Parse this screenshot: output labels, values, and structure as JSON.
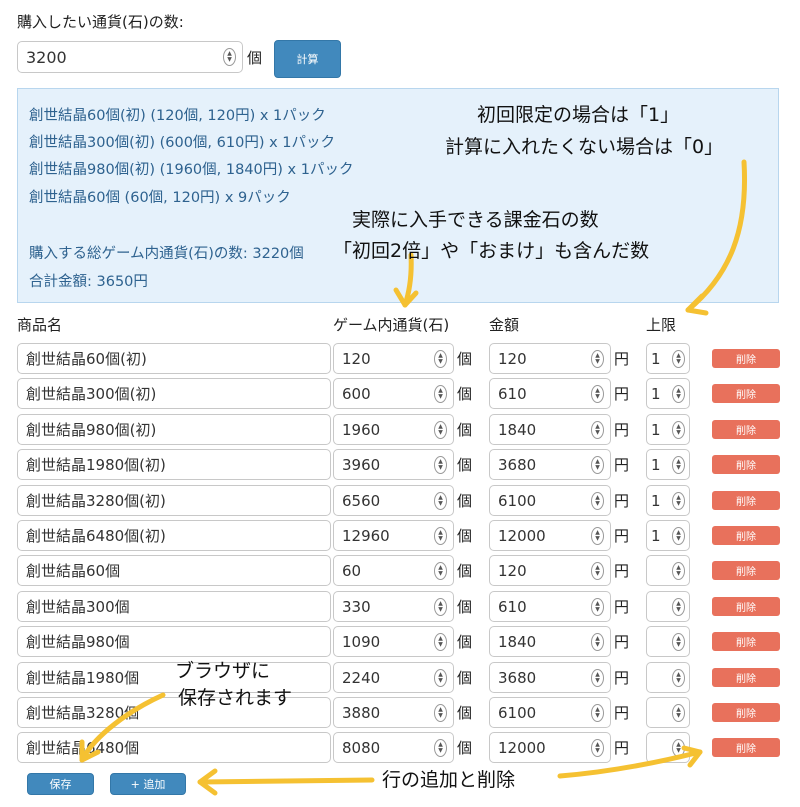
{
  "quantity": {
    "label": "購入したい通貨(石)の数:",
    "value": "3200",
    "unit": "個",
    "calc_button": "計算"
  },
  "result": {
    "packs": [
      "創世結晶60個(初) (120個, 120円) x 1パック",
      "創世結晶300個(初) (600個, 610円) x 1パック",
      "創世結晶980個(初) (1960個, 1840円) x 1パック",
      "創世結晶60個 (60個, 120円) x 9パック"
    ],
    "total_currency": "購入する総ゲーム内通貨(石)の数: 3220個",
    "total_price": "合計金額: 3650円"
  },
  "table": {
    "headers": {
      "name": "商品名",
      "currency": "ゲーム内通貨(石)",
      "price": "金額",
      "limit": "上限"
    },
    "unit_currency": "個",
    "unit_price": "円",
    "delete_label": "削除",
    "rows": [
      {
        "name": "創世結晶60個(初)",
        "currency": "120",
        "price": "120",
        "limit": "1"
      },
      {
        "name": "創世結晶300個(初)",
        "currency": "600",
        "price": "610",
        "limit": "1"
      },
      {
        "name": "創世結晶980個(初)",
        "currency": "1960",
        "price": "1840",
        "limit": "1"
      },
      {
        "name": "創世結晶1980個(初)",
        "currency": "3960",
        "price": "3680",
        "limit": "1"
      },
      {
        "name": "創世結晶3280個(初)",
        "currency": "6560",
        "price": "6100",
        "limit": "1"
      },
      {
        "name": "創世結晶6480個(初)",
        "currency": "12960",
        "price": "12000",
        "limit": "1"
      },
      {
        "name": "創世結晶60個",
        "currency": "60",
        "price": "120",
        "limit": ""
      },
      {
        "name": "創世結晶300個",
        "currency": "330",
        "price": "610",
        "limit": ""
      },
      {
        "name": "創世結晶980個",
        "currency": "1090",
        "price": "1840",
        "limit": ""
      },
      {
        "name": "創世結晶1980個",
        "currency": "2240",
        "price": "3680",
        "limit": ""
      },
      {
        "name": "創世結晶3280個",
        "currency": "3880",
        "price": "6100",
        "limit": ""
      },
      {
        "name": "創世結晶6480個",
        "currency": "8080",
        "price": "12000",
        "limit": ""
      }
    ]
  },
  "footer": {
    "save_button": "保存",
    "add_button": "+ 追加"
  },
  "annotations": {
    "limit_note_1": "初回限定の場合は「1」",
    "limit_note_2": "計算に入れたくない場合は「0」",
    "gem_note_1": "実際に入手できる課金石の数",
    "gem_note_2": "「初回2倍」や「おまけ」も含んだ数",
    "save_note_1": "ブラウザに",
    "save_note_2": "保存されます",
    "row_note": "行の追加と削除"
  },
  "colors": {
    "accent_blue": "#4189bd",
    "delete_red": "#e8715c",
    "result_bg": "#e5f1fb",
    "result_text": "#2e628f",
    "arrow_yellow": "#f5c132"
  }
}
